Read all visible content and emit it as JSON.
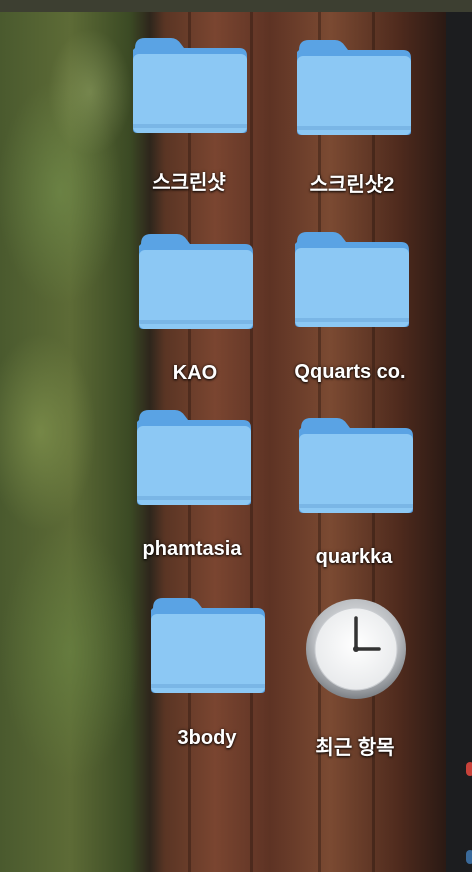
{
  "desktop": {
    "icons": [
      {
        "label": "스크린샷",
        "icon": "folder-icon"
      },
      {
        "label": "스크린샷2",
        "icon": "folder-icon"
      },
      {
        "label": "KAO",
        "icon": "folder-icon"
      },
      {
        "label": "Qquarts co.",
        "icon": "folder-icon"
      },
      {
        "label": "phamtasia",
        "icon": "folder-icon"
      },
      {
        "label": "quarkka",
        "icon": "folder-icon"
      },
      {
        "label": "3body",
        "icon": "folder-icon"
      },
      {
        "label": "최근 항목",
        "icon": "clock-icon"
      }
    ]
  },
  "colors": {
    "folder_body": "#8cc8f4",
    "folder_tab": "#5aa3e4",
    "label_text": "#ffffff"
  }
}
